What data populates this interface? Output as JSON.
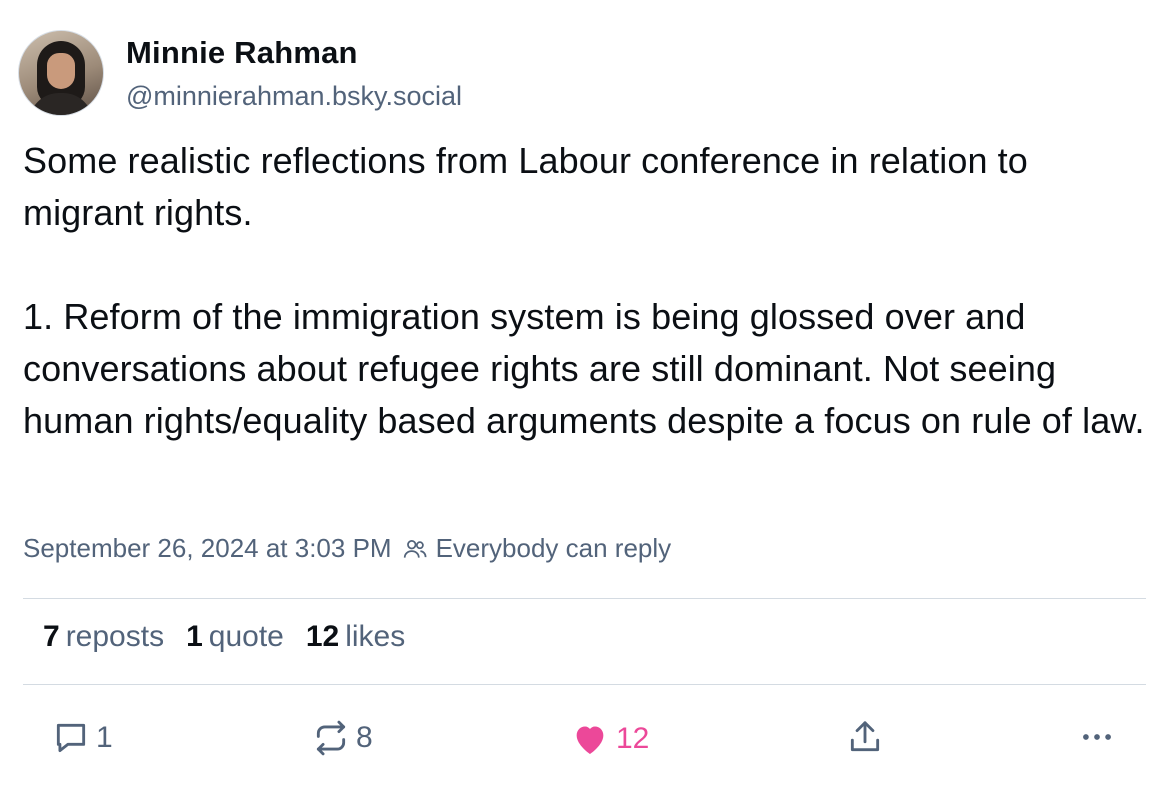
{
  "author": {
    "display_name": "Minnie Rahman",
    "handle": "@minnierahman.bsky.social"
  },
  "post": {
    "paragraph_1": "Some realistic reflections from Labour conference in relation to migrant rights.",
    "paragraph_2": "1. Reform of the immigration system is being glossed over and conversations about refugee rights are still dominant. Not seeing human rights/equality based arguments despite a focus on rule of law."
  },
  "meta": {
    "timestamp": "September 26, 2024 at 3:03 PM",
    "reply_setting": "Everybody can reply",
    "reply_icon": "people-icon"
  },
  "stats": {
    "reposts_count": "7",
    "reposts_label": "reposts",
    "quotes_count": "1",
    "quotes_label": "quote",
    "likes_count": "12",
    "likes_label": "likes"
  },
  "actions": {
    "reply_count": "1",
    "repost_count": "8",
    "like_count": "12",
    "icons": [
      "reply-icon",
      "repost-icon",
      "heart-icon",
      "share-icon",
      "more-icon"
    ]
  },
  "colors": {
    "text": "#0b0f14",
    "muted": "#52637a",
    "like": "#ec4899",
    "divider": "#d4dbe2"
  }
}
